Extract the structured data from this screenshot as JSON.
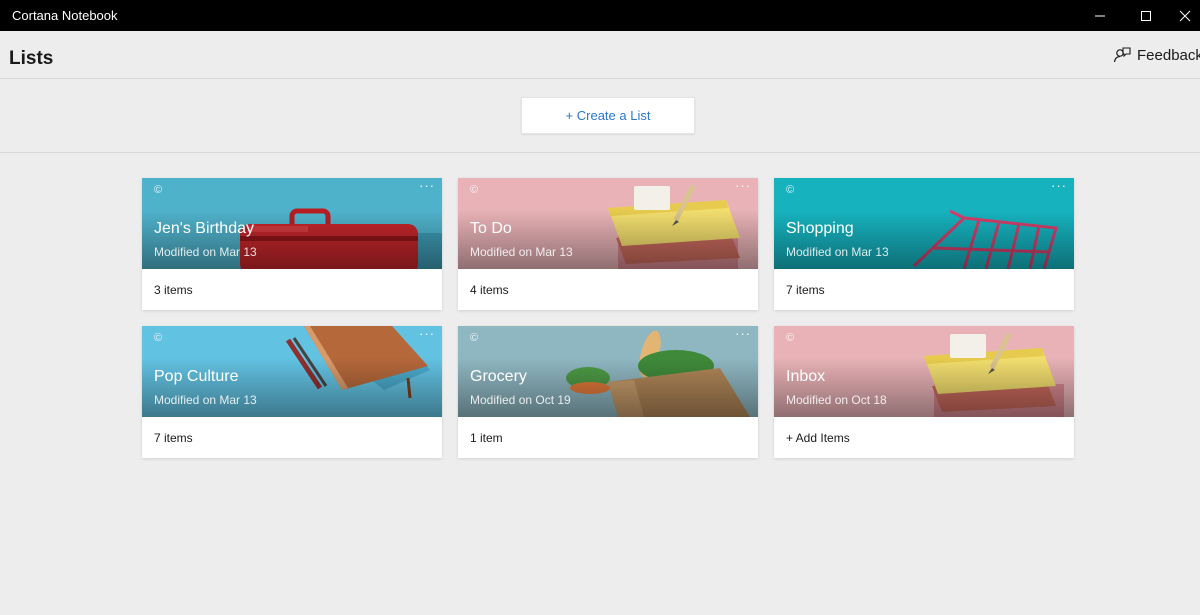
{
  "window": {
    "title": "Cortana Notebook"
  },
  "header": {
    "title": "Lists",
    "feedback_label": "Feedback"
  },
  "create": {
    "label": "+ Create a List"
  },
  "lists": [
    {
      "title": "Jen's Birthday",
      "modified": "Modified on Mar 13",
      "count": "3 items",
      "copyright": "©",
      "more": "···",
      "image_icon": "suitcase"
    },
    {
      "title": "To Do",
      "modified": "Modified on Mar 13",
      "count": "4 items",
      "copyright": "©",
      "more": "···",
      "image_icon": "notepad-stack"
    },
    {
      "title": "Shopping",
      "modified": "Modified on Mar 13",
      "count": "7 items",
      "copyright": "©",
      "more": "···",
      "image_icon": "shopping-cart"
    },
    {
      "title": "Pop Culture",
      "modified": "Modified on Mar 13",
      "count": "7 items",
      "copyright": "©",
      "more": "···",
      "image_icon": "notebook-pen"
    },
    {
      "title": "Grocery",
      "modified": "Modified on Oct 19",
      "count": "1 item",
      "copyright": "©",
      "more": "···",
      "image_icon": "grocery-bag"
    },
    {
      "title": "Inbox",
      "modified": "Modified on Oct 18",
      "count": "+ Add Items",
      "copyright": "©",
      "more": "",
      "image_icon": "notepad-stack"
    }
  ],
  "colors": {
    "accent": "#2b78c5",
    "titlebar": "#000000",
    "background": "#ededed"
  }
}
